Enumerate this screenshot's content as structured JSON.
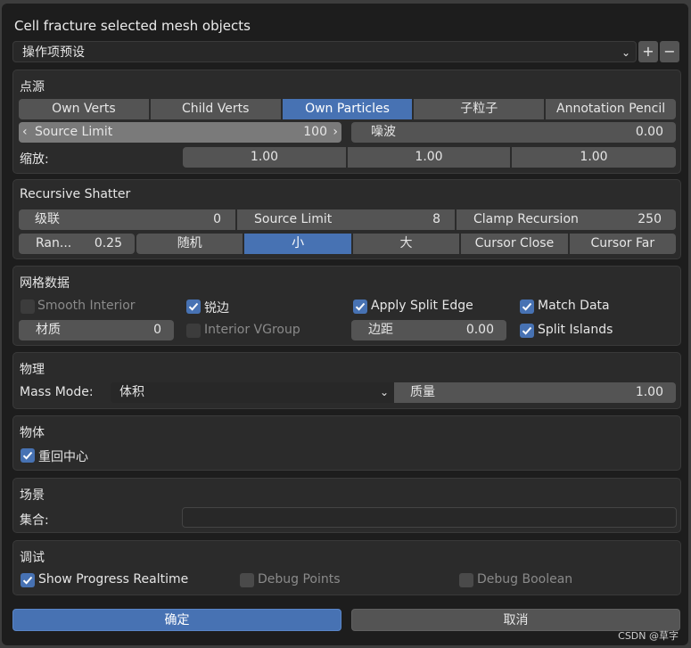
{
  "dialog": {
    "title": "Cell fracture selected mesh objects"
  },
  "preset": {
    "value": "操作项预设",
    "add": "+",
    "remove": "−"
  },
  "source": {
    "title": "点源",
    "tabs": [
      "Own Verts",
      "Child Verts",
      "Own Particles",
      "子粒子",
      "Annotation Pencil"
    ],
    "active_tab": "Own Particles",
    "source_limit_label": "Source Limit",
    "source_limit_value": "100",
    "noise_label": "噪波",
    "noise_value": "0.00",
    "scale_label": "缩放:",
    "scale_values": [
      "1.00",
      "1.00",
      "1.00"
    ]
  },
  "recursive": {
    "title": "Recursive Shatter",
    "level_label": "级联",
    "level_value": "0",
    "source_limit_label": "Source Limit",
    "source_limit_value": "8",
    "clamp_label": "Clamp Recursion",
    "clamp_value": "250",
    "random_label": "Ran...",
    "random_value": "0.25",
    "options": [
      "随机",
      "小",
      "大",
      "Cursor Close",
      "Cursor Far"
    ],
    "active_option": "小"
  },
  "mesh": {
    "title": "网格数据",
    "smooth_interior": "Smooth Interior",
    "sharp_edges": "锐边",
    "apply_split_edge": "Apply Split Edge",
    "match_data": "Match Data",
    "material_label": "材质",
    "material_value": "0",
    "interior_vgroup": "Interior VGroup",
    "margin_label": "边距",
    "margin_value": "0.00",
    "split_islands": "Split Islands"
  },
  "physics": {
    "title": "物理",
    "mass_mode_label": "Mass Mode:",
    "mass_mode_value": "体积",
    "mass_label": "质量",
    "mass_value": "1.00"
  },
  "object": {
    "title": "物体",
    "recenter": "重回中心"
  },
  "scene": {
    "title": "场景",
    "collection_label": "集合:"
  },
  "debug": {
    "title": "调试",
    "show_progress": "Show Progress Realtime",
    "debug_points": "Debug Points",
    "debug_boolean": "Debug Boolean"
  },
  "footer": {
    "ok": "确定",
    "cancel": "取消"
  },
  "watermark": "CSDN @草字",
  "colors": {
    "accent": "#4772b3",
    "panel": "#2b2b2b",
    "field": "#545454",
    "background": "#1d1d1d"
  }
}
